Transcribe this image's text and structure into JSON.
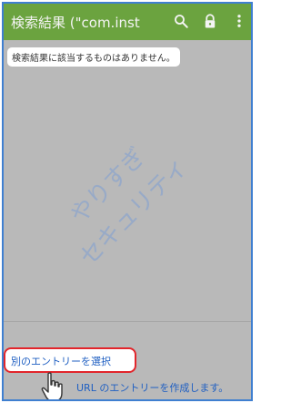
{
  "appbar": {
    "title": "検索結果 (\"com.inst",
    "icons": [
      "search-icon",
      "lock-icon",
      "more-vert-icon"
    ]
  },
  "content": {
    "notice": "検索結果に該当するものはありません。",
    "watermark_lines": [
      "やりすぎ",
      "セキュリティ"
    ]
  },
  "footer": {
    "alt_entry_label": "別のエントリーを選択",
    "create_url_label": "URL のエントリーを作成します。"
  },
  "colors": {
    "appbar": "#6ba33f",
    "frame_border": "#3f7fd0",
    "highlight_border": "#e2252b",
    "link_text": "#1f5fc2",
    "dim_background": "#b9b9b9"
  }
}
